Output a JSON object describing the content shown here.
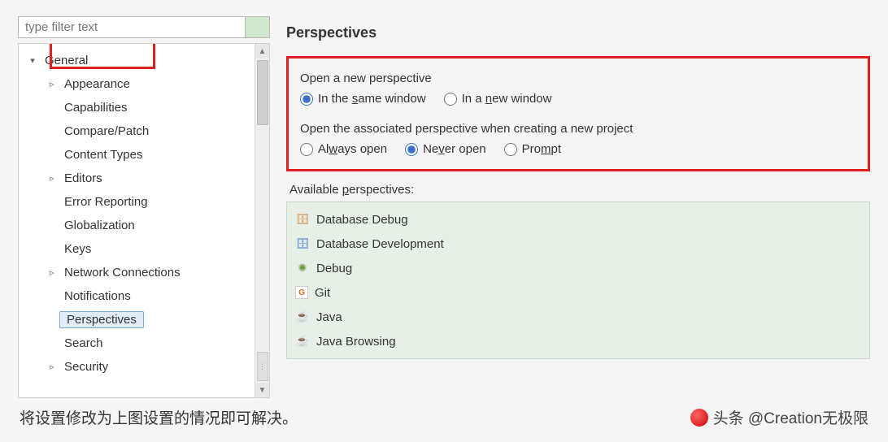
{
  "sidebar": {
    "filter_placeholder": "type filter text",
    "items": [
      {
        "label": "General",
        "indent": 0,
        "arrow": "down",
        "selected": false
      },
      {
        "label": "Appearance",
        "indent": 1,
        "arrow": "right",
        "selected": false
      },
      {
        "label": "Capabilities",
        "indent": 1,
        "arrow": "",
        "selected": false
      },
      {
        "label": "Compare/Patch",
        "indent": 1,
        "arrow": "",
        "selected": false
      },
      {
        "label": "Content Types",
        "indent": 1,
        "arrow": "",
        "selected": false
      },
      {
        "label": "Editors",
        "indent": 1,
        "arrow": "right",
        "selected": false
      },
      {
        "label": "Error Reporting",
        "indent": 1,
        "arrow": "",
        "selected": false
      },
      {
        "label": "Globalization",
        "indent": 1,
        "arrow": "",
        "selected": false
      },
      {
        "label": "Keys",
        "indent": 1,
        "arrow": "",
        "selected": false
      },
      {
        "label": "Network Connections",
        "indent": 1,
        "arrow": "right",
        "selected": false
      },
      {
        "label": "Notifications",
        "indent": 1,
        "arrow": "",
        "selected": false
      },
      {
        "label": "Perspectives",
        "indent": 1,
        "arrow": "",
        "selected": true
      },
      {
        "label": "Search",
        "indent": 1,
        "arrow": "",
        "selected": false
      },
      {
        "label": "Security",
        "indent": 1,
        "arrow": "right",
        "selected": false
      }
    ]
  },
  "content": {
    "title": "Perspectives",
    "group1": {
      "heading": "Open a new perspective",
      "opt_same": "In the same window",
      "opt_new": "In a new window"
    },
    "group2": {
      "heading": "Open the associated perspective when creating a new project",
      "opt_always": "Always open",
      "opt_never": "Never open",
      "opt_prompt": "Prompt"
    },
    "available_label": "Available perspectives:",
    "perspectives": [
      {
        "icon": "🗄",
        "color": "#d08030",
        "label": "Database Debug"
      },
      {
        "icon": "🗄",
        "color": "#3a70c8",
        "label": "Database Development"
      },
      {
        "icon": "✺",
        "color": "#6a9a3a",
        "label": "Debug"
      },
      {
        "icon": "G",
        "color": "#d06a2a",
        "label": "Git"
      },
      {
        "icon": "☕",
        "color": "#c05050",
        "label": "Java"
      },
      {
        "icon": "☕",
        "color": "#5a8aca",
        "label": "Java Browsing"
      }
    ]
  },
  "footer": {
    "note": "将设置修改为上图设置的情况即可解决。",
    "watermark": "头条 @Creation无极限"
  }
}
